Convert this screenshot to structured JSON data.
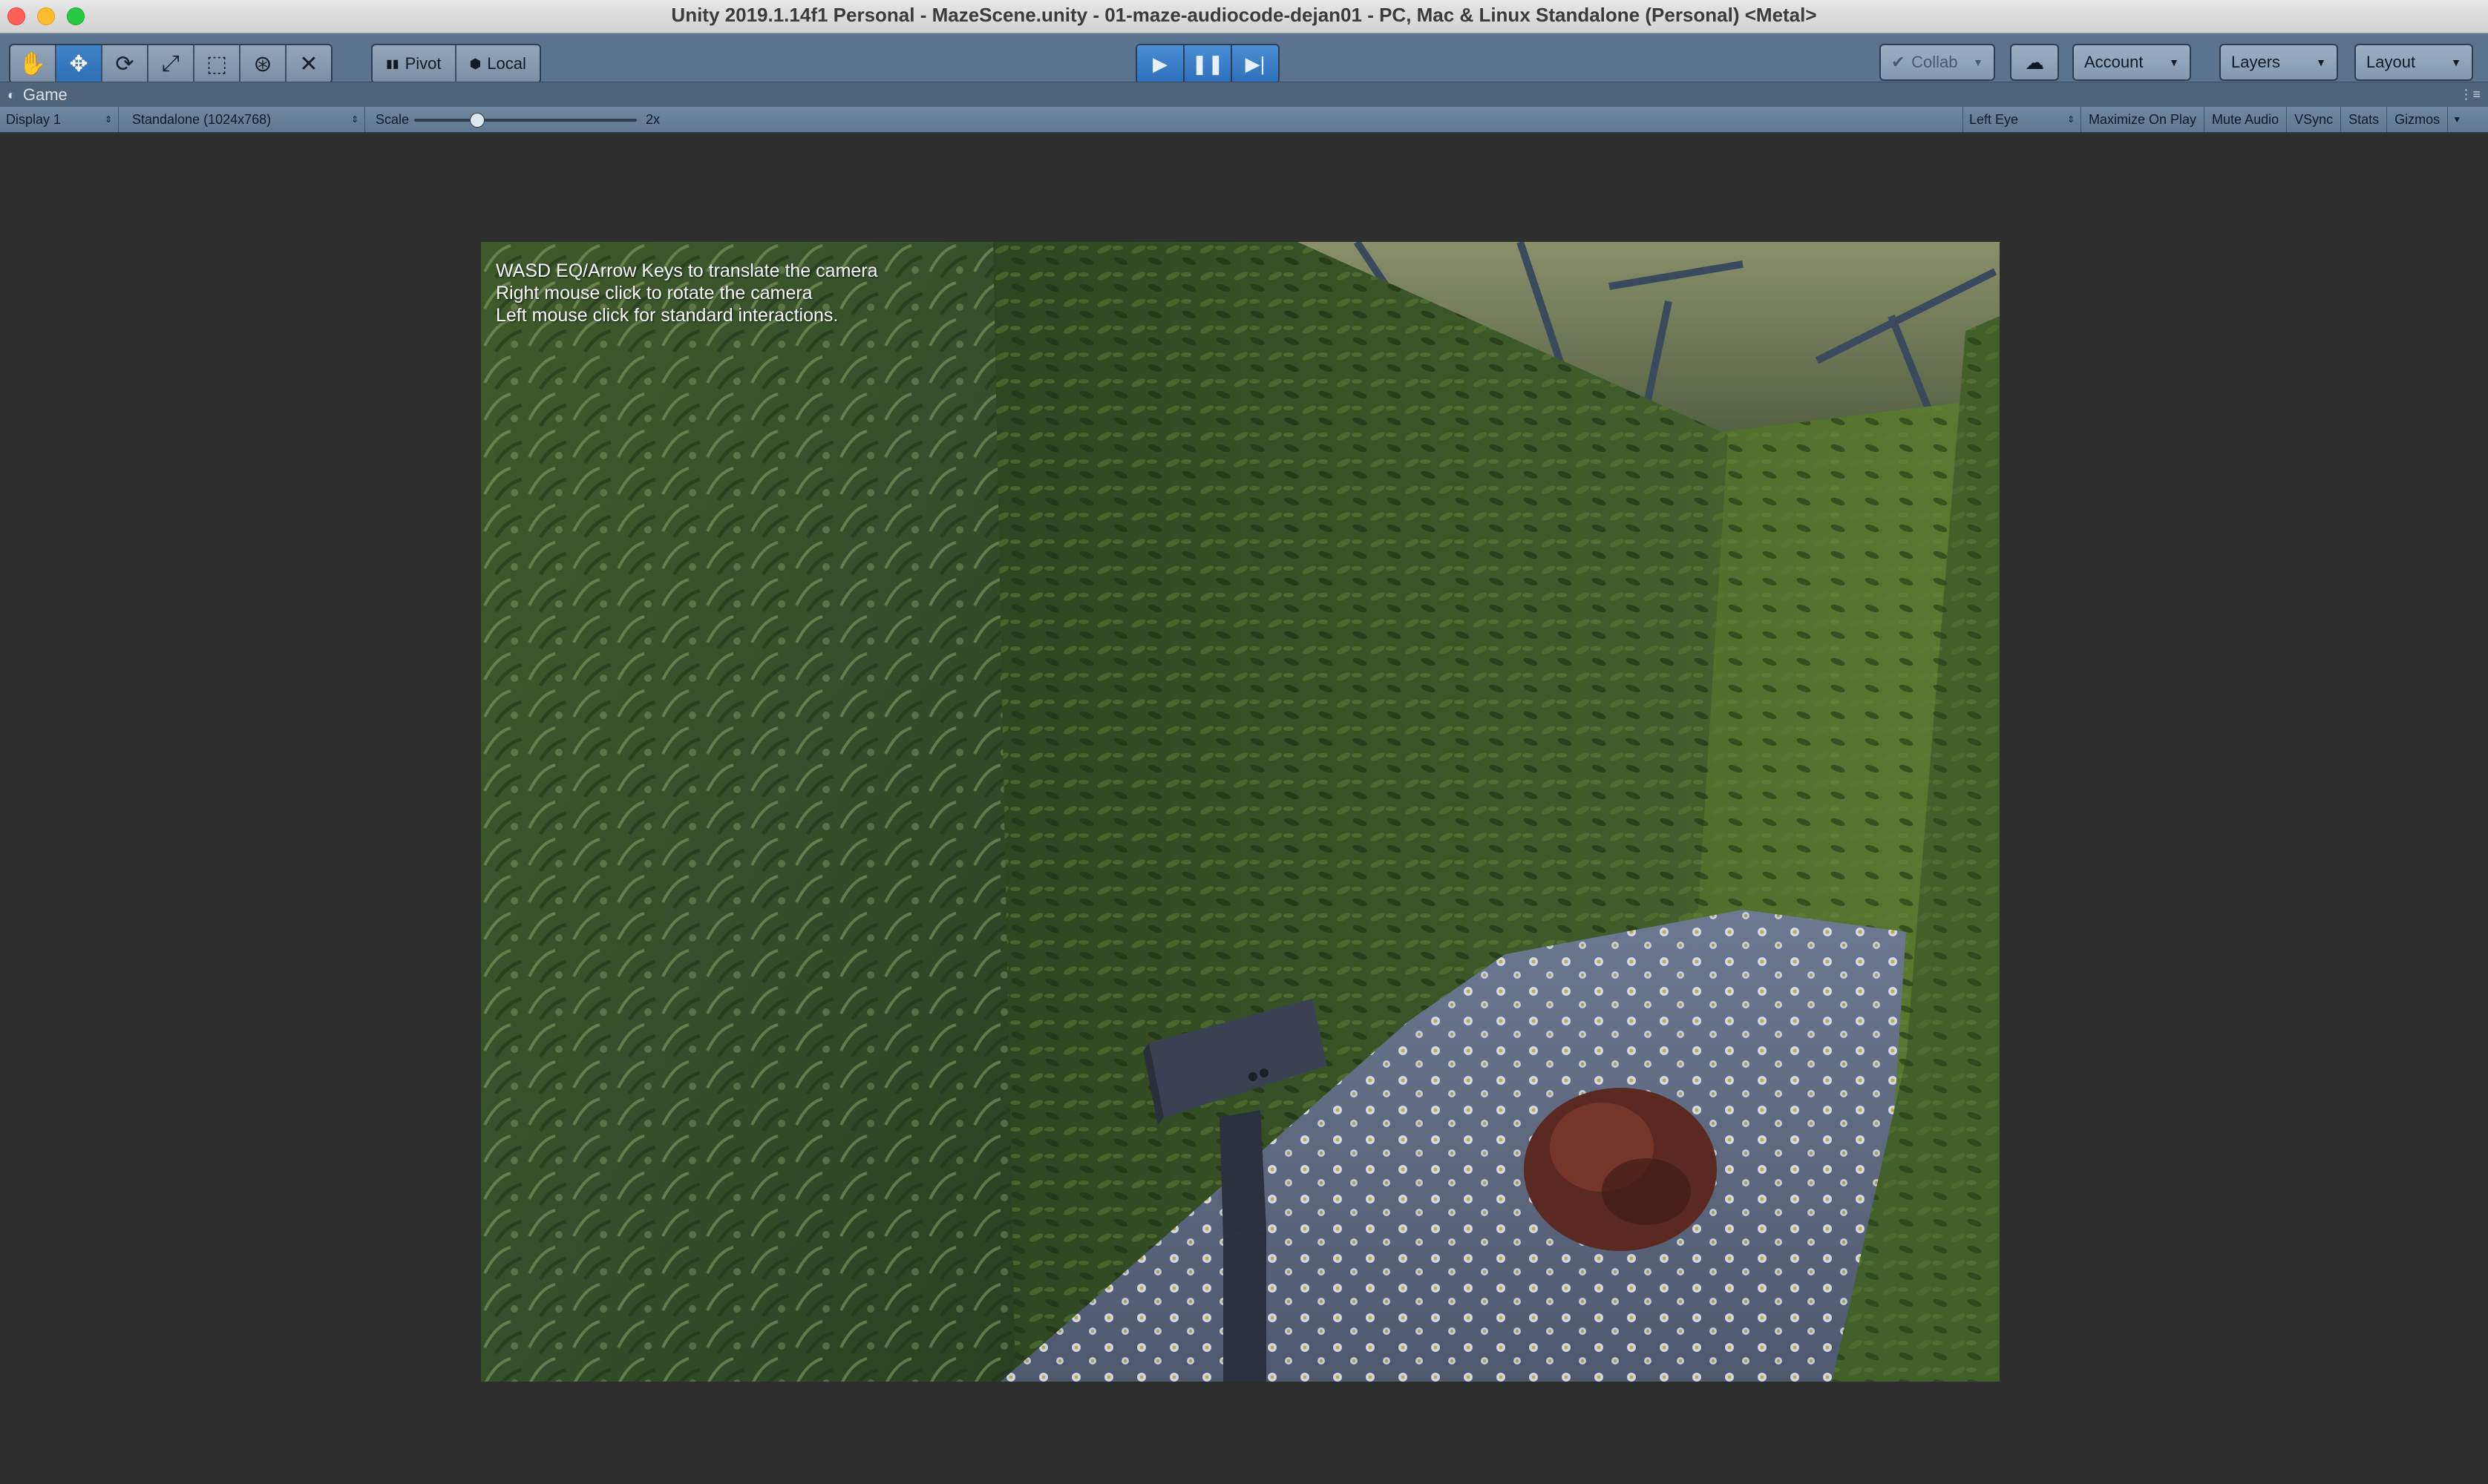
{
  "window": {
    "title": "Unity 2019.1.14f1 Personal - MazeScene.unity - 01-maze-audiocode-dejan01 - PC, Mac & Linux Standalone (Personal) <Metal>"
  },
  "toolbar": {
    "tools": [
      {
        "name": "hand-tool",
        "glyph": "✋"
      },
      {
        "name": "move-tool",
        "glyph": "✥"
      },
      {
        "name": "rotate-tool",
        "glyph": "⟳"
      },
      {
        "name": "scale-tool",
        "glyph": "⤢"
      },
      {
        "name": "rect-tool",
        "glyph": "⬚"
      },
      {
        "name": "transform-tool",
        "glyph": "⊛"
      },
      {
        "name": "custom-tool",
        "glyph": "✕"
      }
    ],
    "active_tool": "move-tool",
    "pivot_label": "Pivot",
    "local_label": "Local",
    "collab_label": "Collab",
    "account_label": "Account",
    "layers_label": "Layers",
    "layout_label": "Layout"
  },
  "tab": {
    "label": "Game"
  },
  "game_view": {
    "display": "Display 1",
    "resolution": "Standalone (1024x768)",
    "scale_label": "Scale",
    "scale_value": "2x",
    "scale_slider_fraction": 0.28,
    "eye": "Left Eye",
    "toggles": [
      "Maximize On Play",
      "Mute Audio",
      "VSync",
      "Stats",
      "Gizmos"
    ]
  },
  "scene": {
    "hint_lines": [
      "WASD EQ/Arrow Keys to translate the camera",
      "Right mouse click to rotate the camera",
      "Left mouse click for standard interactions."
    ]
  },
  "colors": {
    "play_blue": "#2d6fbb",
    "toolbar": "#5a748f",
    "hedge_dark": "#27391b",
    "hedge_light": "#4f6b2c",
    "path_stone": "#58627a"
  }
}
